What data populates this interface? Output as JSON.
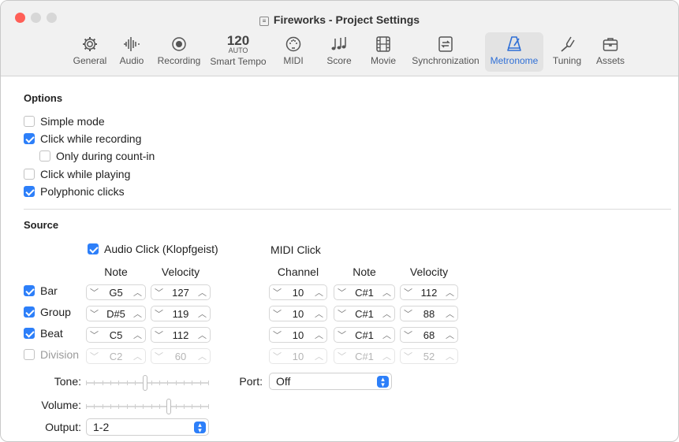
{
  "window": {
    "title": "Fireworks - Project Settings"
  },
  "tabs": [
    {
      "label": "General",
      "icon": "gear-icon"
    },
    {
      "label": "Audio",
      "icon": "waveform-icon"
    },
    {
      "label": "Recording",
      "icon": "record-icon"
    },
    {
      "label": "Smart Tempo",
      "icon": "tempo-display",
      "tempo": "120",
      "tempo_sub": "AUTO"
    },
    {
      "label": "MIDI",
      "icon": "midi-port-icon"
    },
    {
      "label": "Score",
      "icon": "music-notes-icon"
    },
    {
      "label": "Movie",
      "icon": "film-icon"
    },
    {
      "label": "Synchronization",
      "icon": "sync-icon"
    },
    {
      "label": "Metronome",
      "icon": "metronome-icon",
      "active": true
    },
    {
      "label": "Tuning",
      "icon": "tuning-fork-icon"
    },
    {
      "label": "Assets",
      "icon": "briefcase-icon"
    }
  ],
  "options": {
    "title": "Options",
    "simple_mode": "Simple mode",
    "click_while_recording": "Click while recording",
    "only_during_count_in": "Only during count-in",
    "click_while_playing": "Click while playing",
    "polyphonic_clicks": "Polyphonic clicks"
  },
  "source": {
    "title": "Source",
    "audio_click_label": "Audio Click (Klopfgeist)",
    "midi_click_label": "MIDI Click",
    "headers": {
      "note": "Note",
      "velocity": "Velocity",
      "channel": "Channel",
      "midi_note": "Note",
      "midi_velocity": "Velocity"
    },
    "rows": [
      {
        "label": "Bar",
        "checked": true,
        "note": "G5",
        "velocity": "127",
        "channel": "10",
        "midi_note": "C#1",
        "midi_velocity": "112"
      },
      {
        "label": "Group",
        "checked": true,
        "note": "D#5",
        "velocity": "119",
        "channel": "10",
        "midi_note": "C#1",
        "midi_velocity": "88"
      },
      {
        "label": "Beat",
        "checked": true,
        "note": "C5",
        "velocity": "112",
        "channel": "10",
        "midi_note": "C#1",
        "midi_velocity": "68"
      },
      {
        "label": "Division",
        "checked": false,
        "note": "C2",
        "velocity": "60",
        "channel": "10",
        "midi_note": "C#1",
        "midi_velocity": "52"
      }
    ],
    "tone_label": "Tone:",
    "volume_label": "Volume:",
    "output_label": "Output:",
    "output_value": "1-2",
    "port_label": "Port:",
    "port_value": "Off",
    "tone_level": 0.48,
    "volume_level": 0.68
  },
  "colors": {
    "accent": "#2d7ff9",
    "close": "#ff5f57"
  }
}
